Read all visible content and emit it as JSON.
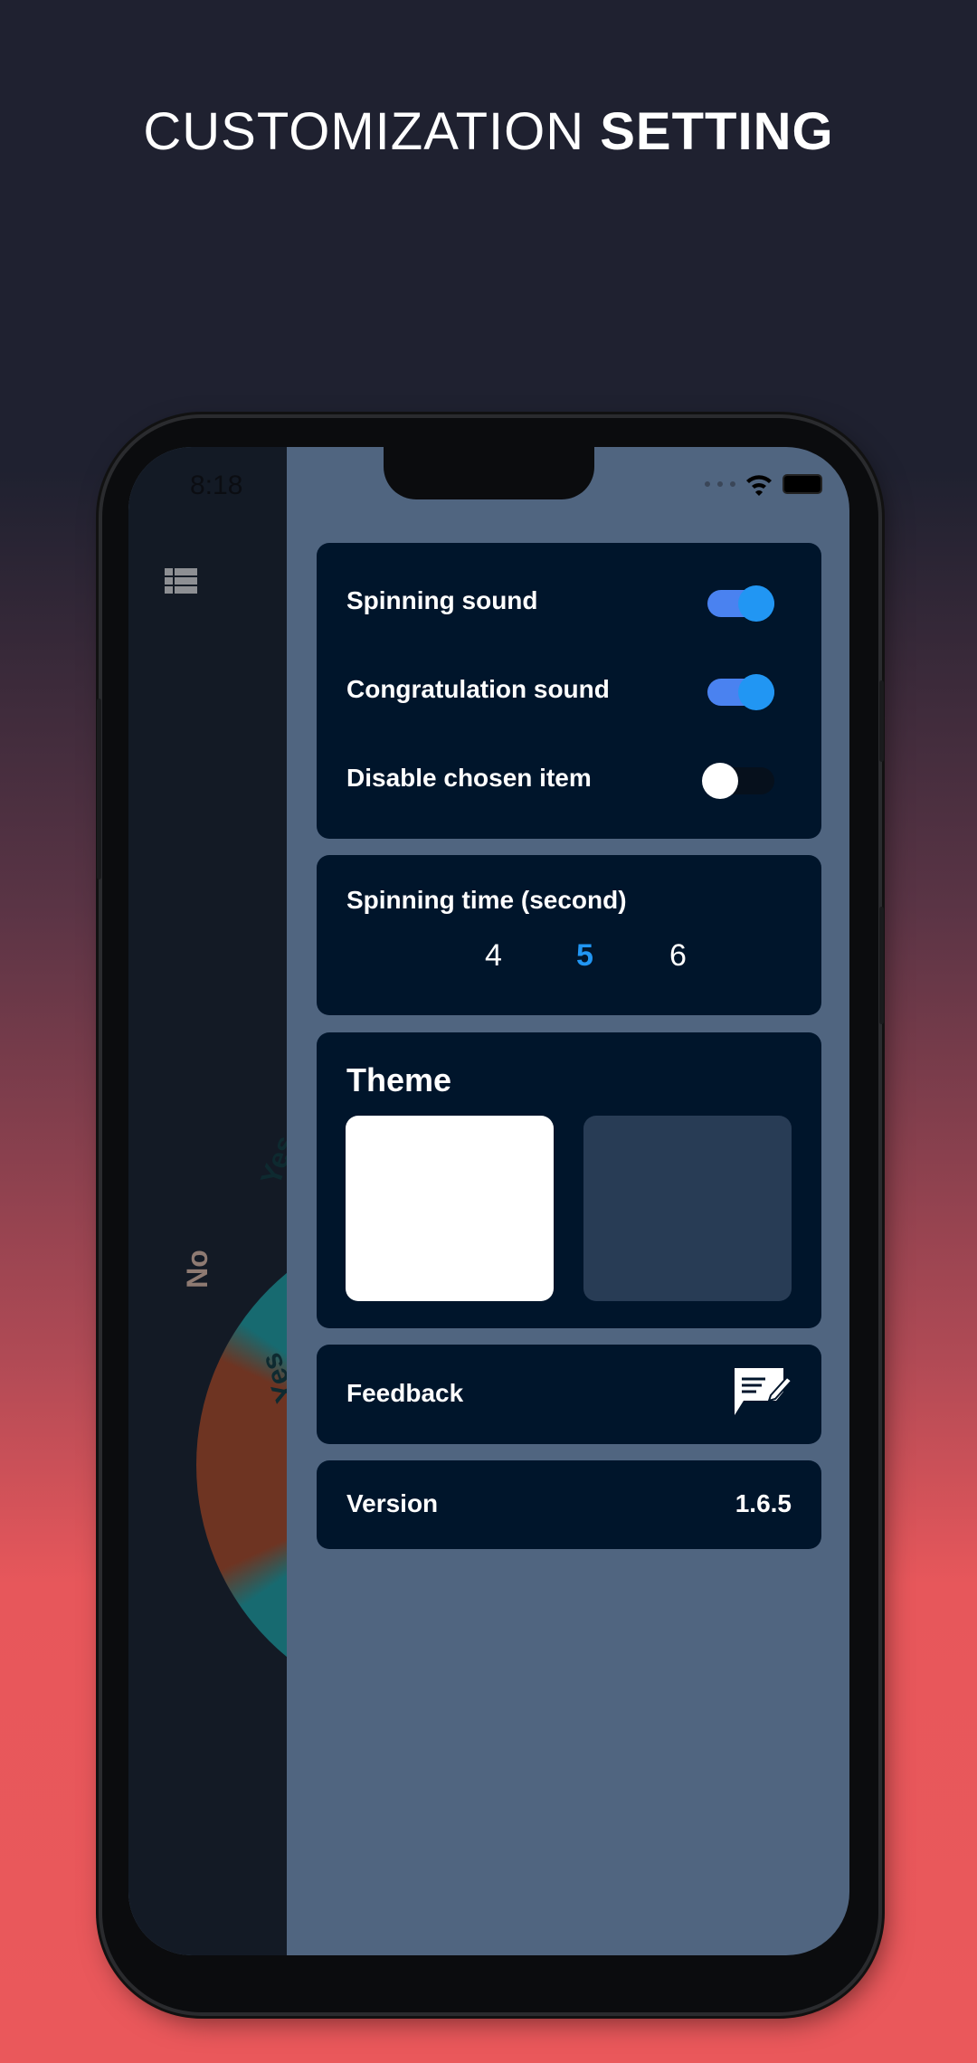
{
  "headline": {
    "light": "CUSTOMIZATION",
    "bold": "SETTING"
  },
  "status_bar": {
    "time": "8:18"
  },
  "wheel": {
    "segments": [
      "Yes",
      "No",
      "Yes"
    ]
  },
  "settings": {
    "toggles": [
      {
        "label": "Spinning sound",
        "on": true
      },
      {
        "label": "Congratulation sound",
        "on": true
      },
      {
        "label": "Disable chosen item",
        "on": false
      }
    ],
    "spinning_time": {
      "label": "Spinning time (second)",
      "options": [
        "4",
        "5",
        "6"
      ],
      "selected": "5"
    },
    "theme": {
      "label": "Theme",
      "options": [
        "light",
        "dark"
      ],
      "colors": [
        "#ffffff",
        "#283c55"
      ]
    },
    "feedback": {
      "label": "Feedback",
      "icon": "feedback-edit-icon"
    },
    "version": {
      "label": "Version",
      "value": "1.6.5"
    }
  },
  "colors": {
    "accent": "#2196f3",
    "card": "#00152b",
    "panel": "#506580"
  }
}
